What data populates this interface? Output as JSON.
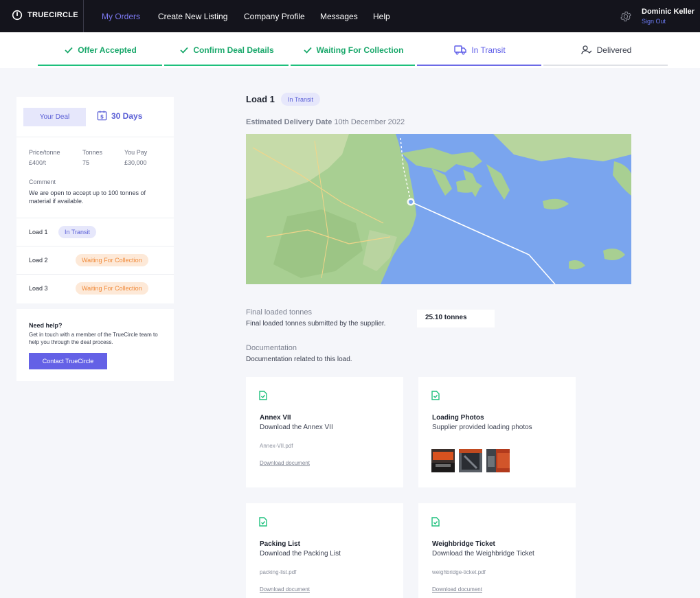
{
  "nav": {
    "brand": "TRUECIRCLE",
    "items": [
      "My Orders",
      "Create New Listing",
      "Company Profile",
      "Messages",
      "Help"
    ],
    "user_name": "Dominic Keller",
    "sign_out": "Sign Out",
    "accent": "#7b78f0"
  },
  "steps": [
    {
      "label": "Offer Accepted",
      "state": "done"
    },
    {
      "label": "Confirm Deal Details",
      "state": "done"
    },
    {
      "label": "Waiting For Collection",
      "state": "done"
    },
    {
      "label": "In Transit",
      "state": "current"
    },
    {
      "label": "Delivered",
      "state": "todo"
    }
  ],
  "deal": {
    "your_deal": "Your Deal",
    "days": "30 Days",
    "price_label": "Price/tonne",
    "price_value": "£400/t",
    "tonnes_label": "Tonnes",
    "tonnes_value": "75",
    "pay_label": "You Pay",
    "pay_value": "£30,000",
    "comment_label": "Comment",
    "comment_text": "We are open to accept up to 100 tonnes of material if available.",
    "loads": [
      {
        "name": "Load 1",
        "status": "In Transit"
      },
      {
        "name": "Load 2",
        "status": "Waiting For Collection"
      },
      {
        "name": "Load 3",
        "status": "Waiting For Collection"
      }
    ]
  },
  "help": {
    "title": "Need help?",
    "text": "Get in touch with a member of the TrueCircle team to help you through the deal process.",
    "button": "Contact TrueCircle"
  },
  "main": {
    "load_title": "Load 1",
    "load_status": "In Transit",
    "est_label": "Estimated Delivery Date",
    "est_value": "10th December 2022",
    "final_label": "Final loaded tonnes",
    "final_desc": "Final loaded tonnes submitted by the supplier.",
    "final_value": "25.10 tonnes",
    "docs_label": "Documentation",
    "docs_desc": "Documentation related to this load."
  },
  "documents": [
    {
      "title": "Annex VII",
      "subtitle": "Download the Annex VII",
      "file": "Annex-VII.pdf",
      "link": "Download document"
    },
    {
      "title": "Loading Photos",
      "subtitle": "Supplier provided loading photos"
    },
    {
      "title": "Packing List",
      "subtitle": "Download the Packing List",
      "file": "packing-list.pdf",
      "link": "Download document"
    },
    {
      "title": "Weighbridge Ticket",
      "subtitle": "Download the Weighbridge Ticket",
      "file": "weighbridge-ticket.pdf",
      "link": "Download document"
    }
  ]
}
